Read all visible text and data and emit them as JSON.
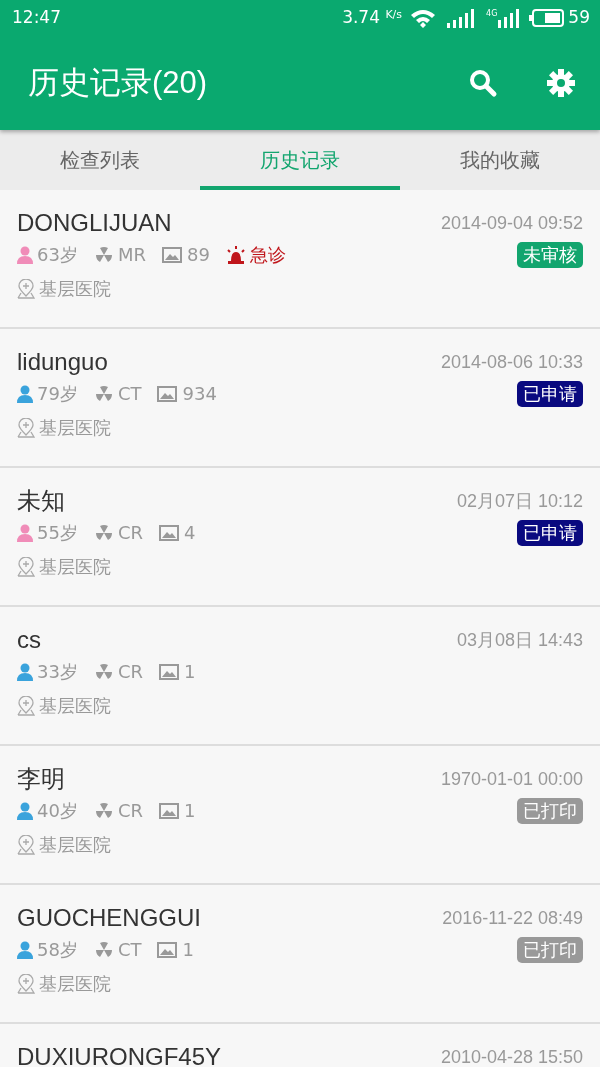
{
  "status_bar": {
    "time": "12:47",
    "speed": "3.74",
    "speed_unit": "K/s",
    "network": "4G",
    "battery_text": "59"
  },
  "app_bar": {
    "title": "历史记录(20)"
  },
  "tabs": [
    {
      "label": "检查列表",
      "selected": false
    },
    {
      "label": "历史记录",
      "selected": true
    },
    {
      "label": "我的收藏",
      "selected": false
    }
  ],
  "records": [
    {
      "name": "DONGLIJUAN",
      "time": "2014-09-04 09:52",
      "person_icon": {
        "color": "#f08cb8"
      },
      "age": "63岁",
      "modality": "MR",
      "images": "89",
      "urgent": true,
      "urgent_label": "急诊",
      "hospital": "基层医院",
      "status": {
        "label": "未审核",
        "color": "#12a56e"
      }
    },
    {
      "name": "lidunguo",
      "time": "2014-08-06 10:33",
      "person_icon": {
        "color": "#3aa3dc"
      },
      "age": "79岁",
      "modality": "CT",
      "images": "934",
      "urgent": false,
      "hospital": "基层医院",
      "status": {
        "label": "已申请",
        "color": "#0a0a80"
      }
    },
    {
      "name": "未知",
      "time": "02月07日 10:12",
      "person_icon": {
        "color": "#f08cb8"
      },
      "age": "55岁",
      "modality": "CR",
      "images": "4",
      "urgent": false,
      "hospital": "基层医院",
      "status": {
        "label": "已申请",
        "color": "#0a0a80"
      }
    },
    {
      "name": "cs",
      "time": "03月08日 14:43",
      "person_icon": {
        "color": "#3aa3dc"
      },
      "age": "33岁",
      "modality": "CR",
      "images": "1",
      "urgent": false,
      "hospital": "基层医院"
    },
    {
      "name": "李明",
      "time": "1970-01-01 00:00",
      "person_icon": {
        "color": "#3aa3dc"
      },
      "age": "40岁",
      "modality": "CR",
      "images": "1",
      "urgent": false,
      "hospital": "基层医院",
      "status": {
        "label": "已打印",
        "color": "#999999"
      }
    },
    {
      "name": "GUOCHENGGUI",
      "time": "2016-11-22 08:49",
      "person_icon": {
        "color": "#3aa3dc"
      },
      "age": "58岁",
      "modality": "CT",
      "images": "1",
      "urgent": false,
      "hospital": "基层医院",
      "status": {
        "label": "已打印",
        "color": "#999999"
      }
    },
    {
      "name": "DUXIURONGF45Y",
      "time": "2010-04-28 15:50"
    }
  ]
}
